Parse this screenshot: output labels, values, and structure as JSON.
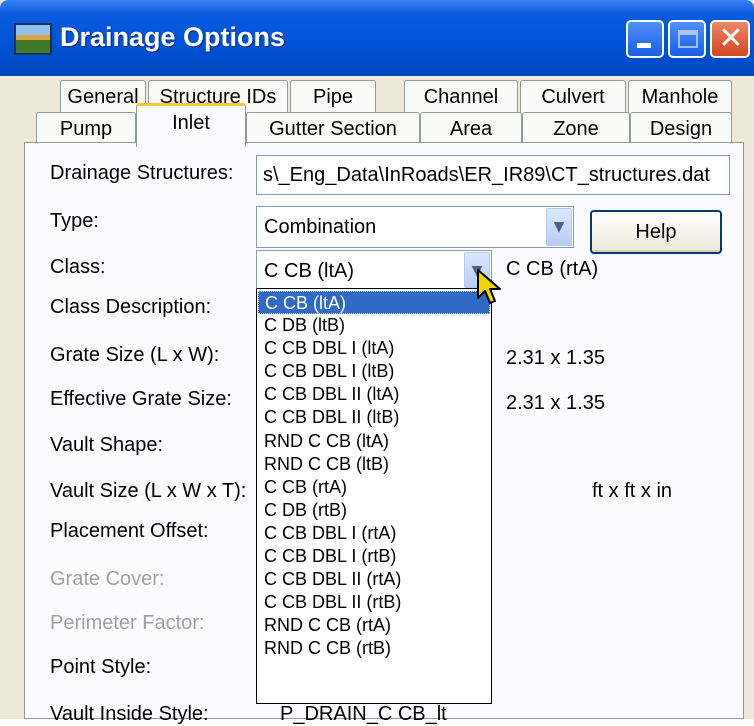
{
  "window": {
    "title": "Drainage Options"
  },
  "tabs_row1": [
    "General",
    "Structure IDs",
    "Pipe",
    "Channel",
    "Culvert",
    "Manhole"
  ],
  "tabs_row2": [
    "Pump",
    "Inlet",
    "Gutter Section",
    "Area",
    "Zone",
    "Design"
  ],
  "active_tab": "Inlet",
  "labels": {
    "drainage_structures": "Drainage Structures:",
    "type": "Type:",
    "class": "Class:",
    "class_description": "Class Description:",
    "grate_size": "Grate Size (L x W):",
    "effective_grate_size": "Effective Grate Size:",
    "vault_shape": "Vault Shape:",
    "vault_size": "Vault Size (L x W x T):",
    "placement_offset": "Placement Offset:",
    "grate_cover": "Grate Cover:",
    "perimeter_factor": "Perimeter Factor:",
    "point_style": "Point Style:",
    "vault_inside_style": "Vault Inside Style:"
  },
  "fields": {
    "drainage_structures_value": "s\\_Eng_Data\\InRoads\\ER_IR89\\CT_structures.dat",
    "type_value": "Combination",
    "class_value": "C CB (ltA)",
    "class_right_value": "C CB (rtA)",
    "grate_size_value": "2.31 x 1.35",
    "effective_grate_size_value": "2.31 x 1.35",
    "vault_size_units": "ft x ft x in",
    "vault_inside_style_value": "P_DRAIN_C CB_lt"
  },
  "buttons": {
    "help": "Help"
  },
  "class_options": [
    "C CB (ltA)",
    "C DB (ltB)",
    "C CB DBL I (ltA)",
    "C CB DBL I (ltB)",
    "C CB DBL II (ltA)",
    "C CB DBL II (ltB)",
    "RND C CB (ltA)",
    "RND C CB (ltB)",
    "C CB (rtA)",
    "C DB (rtB)",
    "C CB DBL I (rtA)",
    "C CB DBL I (rtB)",
    "C CB DBL II (rtA)",
    "C CB DBL II (rtB)",
    "RND C CB (rtA)",
    "RND C CB (rtB)"
  ],
  "selected_class_index": 0,
  "colors": {
    "titlebar": "#0052d6",
    "selection": "#316ac5",
    "active_tab_accent": "#ffc83c",
    "close_button": "#d4461f"
  }
}
